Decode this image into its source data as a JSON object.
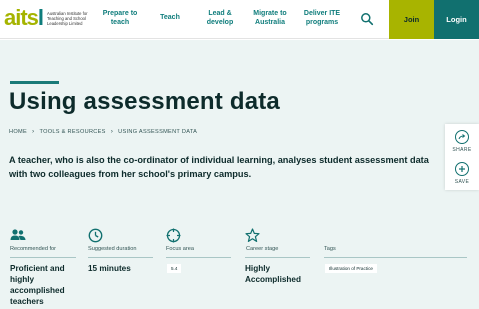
{
  "header": {
    "logo_word": "aitsl",
    "logo_subtitle": "Australian Institute for Teaching and School Leadership Limited",
    "nav": [
      {
        "line1": "Prepare to",
        "line2": "teach"
      },
      {
        "line1": "Teach",
        "line2": ""
      },
      {
        "line1": "Lead &",
        "line2": "develop"
      },
      {
        "line1": "Migrate to",
        "line2": "Australia"
      },
      {
        "line1": "Deliver ITE",
        "line2": "programs"
      }
    ],
    "search_icon": "search-icon",
    "join_label": "Join",
    "login_label": "Login"
  },
  "page": {
    "title": "Using assessment data",
    "breadcrumb": [
      "HOME",
      "TOOLS & RESOURCES",
      "USING ASSESSMENT DATA"
    ],
    "lead_line1": "A teacher, who is also the co-ordinator of individual learning, analyses student assessment data",
    "lead_line2": "with two colleagues from her school's primary campus."
  },
  "side": {
    "share_label": "SHARE",
    "save_label": "SAVE"
  },
  "meta": {
    "recommended": {
      "label": "Recommended for",
      "lines": [
        "Proficient and",
        "highly",
        "accomplished",
        "teachers"
      ]
    },
    "duration": {
      "label": "Suggested duration",
      "value": "15 minutes"
    },
    "focus": {
      "label": "Focus area",
      "tag": "5.4"
    },
    "career": {
      "label": "Career stage",
      "lines": [
        "Highly",
        "Accomplished"
      ]
    },
    "tags": {
      "label": "Tags",
      "tag": "Illustration of Practice"
    }
  },
  "colors": {
    "brand_teal": "#11706f",
    "brand_lime": "#a8b400",
    "hero_bg": "#ecf4f3"
  }
}
